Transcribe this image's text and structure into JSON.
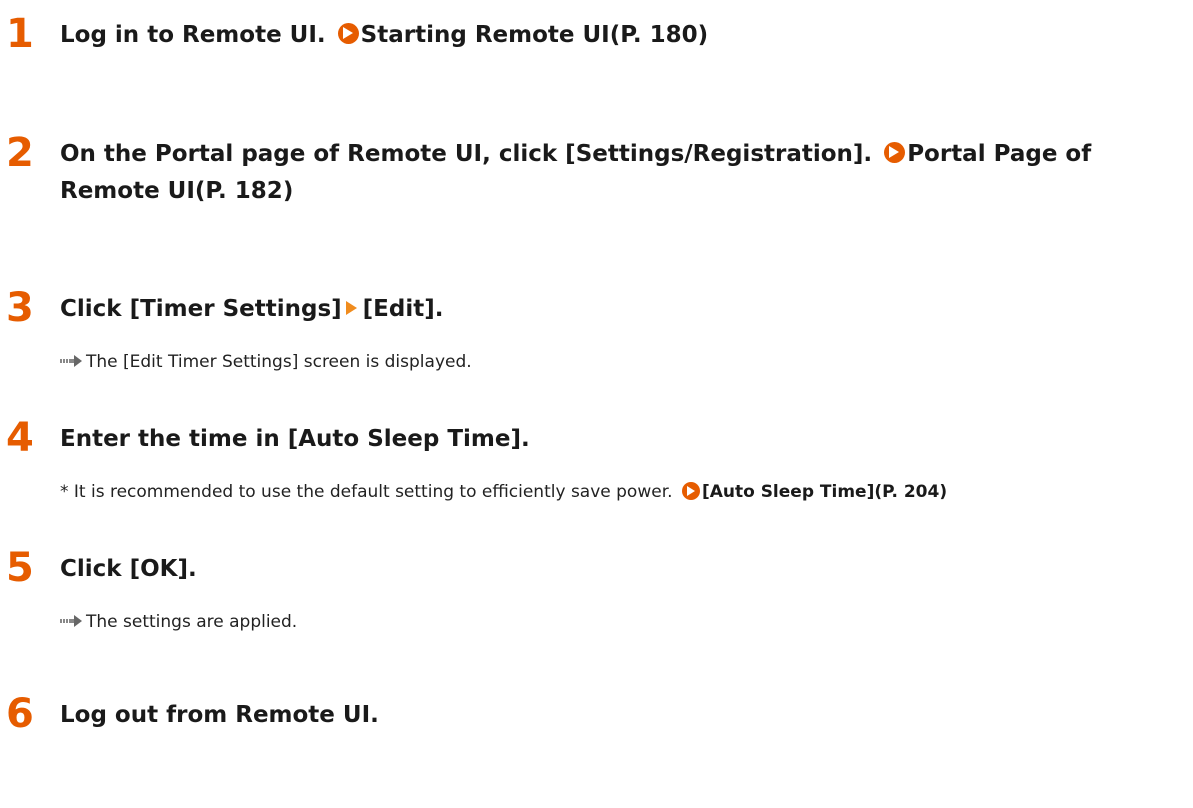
{
  "steps": [
    {
      "number": "1",
      "text": "Log in to Remote UI.",
      "link": "Starting Remote UI(P. 180)"
    },
    {
      "number": "2",
      "text": "On the Portal page of Remote UI, click [Settings/Registration].",
      "link_line1": "Portal Page of",
      "link_line2": "Remote UI(P. 182)"
    },
    {
      "number": "3",
      "text_before": "Click [Timer Settings]",
      "text_after": "[Edit].",
      "result": "The [Edit Timer Settings] screen is displayed."
    },
    {
      "number": "4",
      "text": "Enter the time in [Auto Sleep Time].",
      "note": "* It is recommended to use the default setting to efficiently save power.",
      "note_link": "[Auto Sleep Time](P. 204)"
    },
    {
      "number": "5",
      "text": "Click [OK].",
      "result": "The settings are applied."
    },
    {
      "number": "6",
      "text": "Log out from Remote UI."
    }
  ],
  "colors": {
    "step_number": "#e65c00",
    "link_icon": "#e65c00",
    "arrow_icon": "#f08c1e",
    "result_icon": "#888888"
  }
}
